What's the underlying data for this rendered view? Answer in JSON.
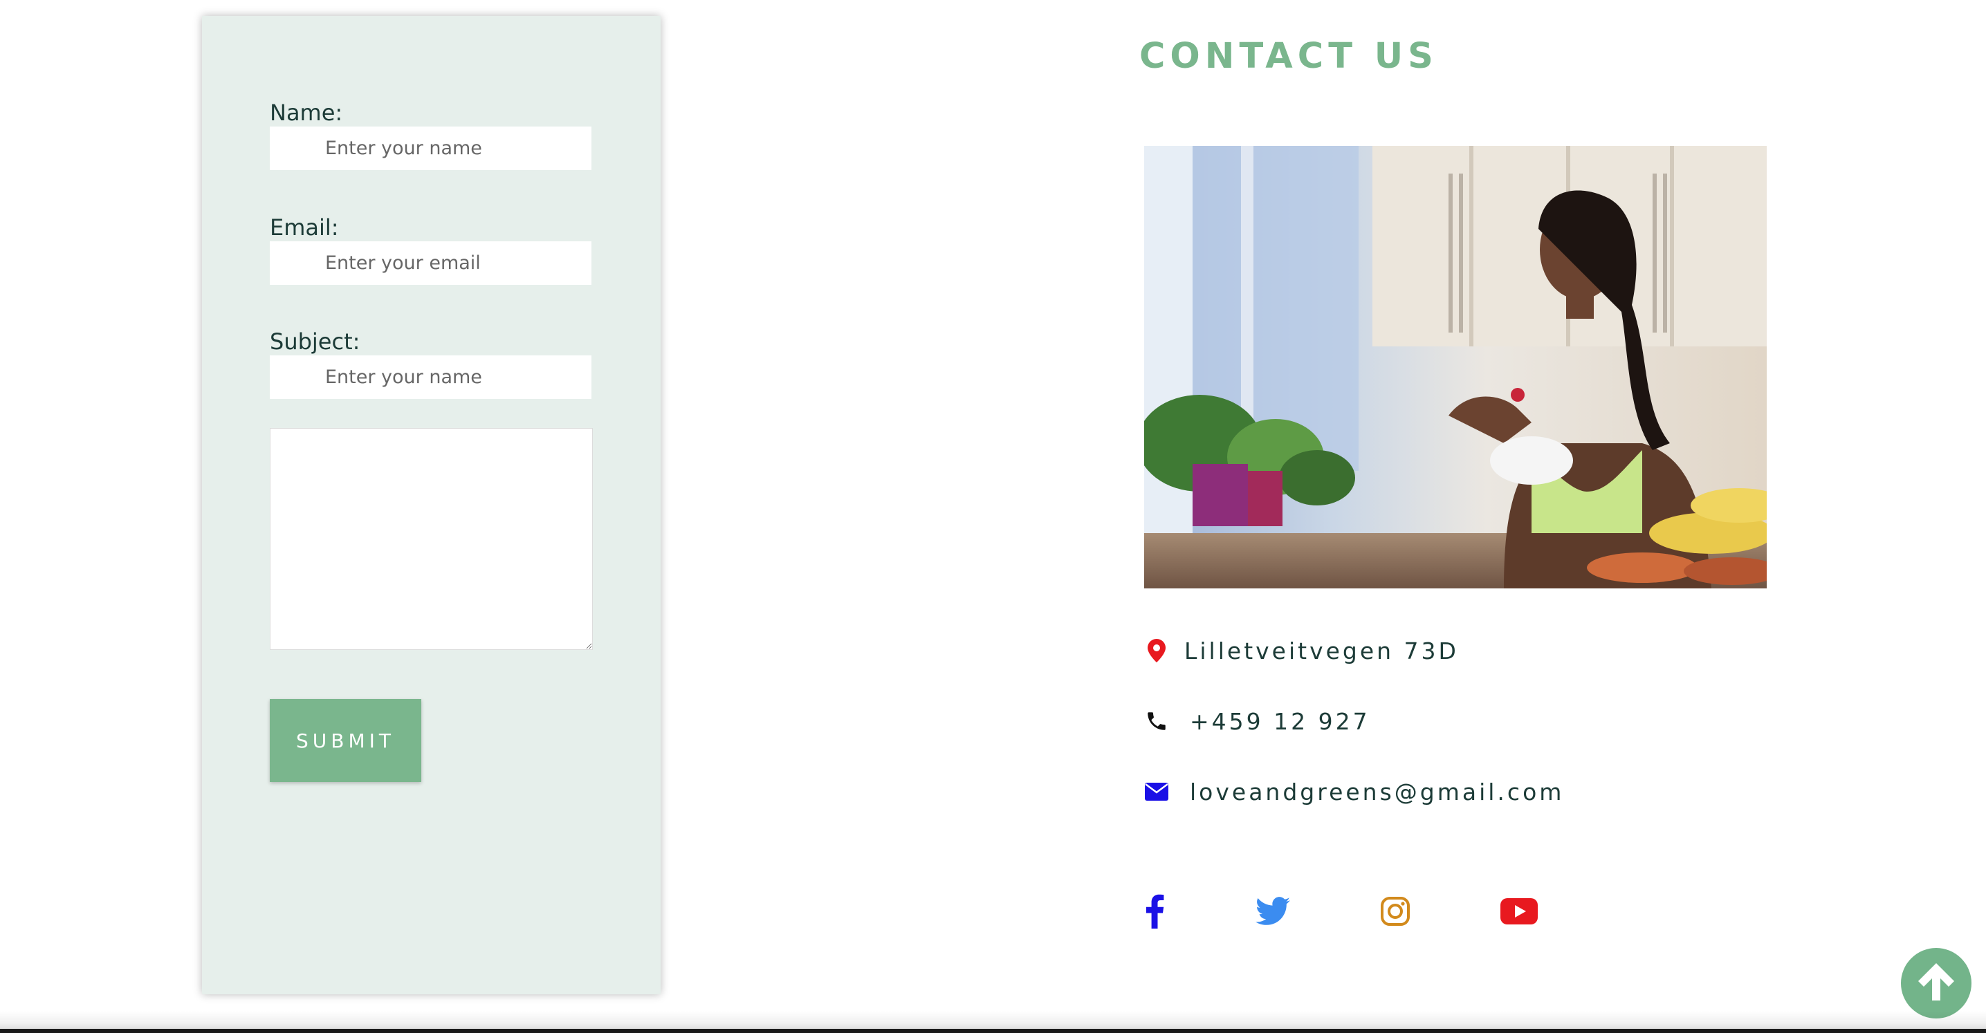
{
  "form": {
    "name_label": "Name:",
    "name_placeholder": "Enter your name",
    "email_label": "Email:",
    "email_placeholder": "Enter your email",
    "subject_label": "Subject:",
    "subject_placeholder": "Enter your name",
    "message_value": "",
    "submit_label": "SUBMIT"
  },
  "contact": {
    "title": "CONTACT US",
    "photo_icon": "woman-eating-salad-photo",
    "address": "Lilletveitvegen 73D",
    "phone": "+459 12 927",
    "email": "loveandgreens@gmail.com",
    "address_icon": "map-pin-icon",
    "phone_icon": "phone-icon",
    "email_icon": "envelope-icon"
  },
  "social": [
    {
      "name": "facebook",
      "icon": "facebook-icon",
      "color": "#1a10e6"
    },
    {
      "name": "twitter",
      "icon": "twitter-icon",
      "color": "#3b8cf0"
    },
    {
      "name": "instagram",
      "icon": "instagram-icon",
      "color": "#d28a1c"
    },
    {
      "name": "youtube",
      "icon": "youtube-icon",
      "color": "#e8191f"
    }
  ],
  "colors": {
    "accent_green": "#7ab68d",
    "form_background": "#e6efeb",
    "text_dark": "#1c3b37",
    "pin_red": "#e8191f",
    "envelope_blue": "#1a10e6",
    "back_to_top": "#73b48a"
  },
  "back_to_top_icon": "arrow-up-icon"
}
